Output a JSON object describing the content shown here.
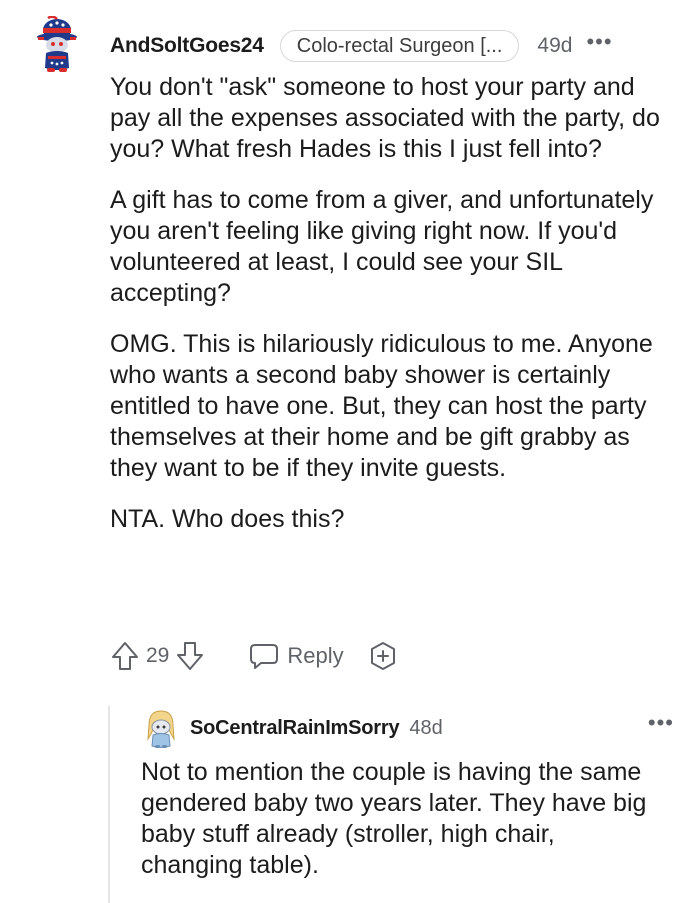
{
  "comment": {
    "username": "AndSoltGoes24",
    "flair": "Colo-rectal Surgeon [...",
    "age": "49d",
    "more_icon": "more-horizontal-icon",
    "paragraphs": [
      "You don't \"ask\" someone to host your party and pay all the expenses associated with the party, do you? What fresh Hades is this I just fell into?",
      "A gift has to come from a giver, and unfortunately you aren't feeling like giving right now. If you'd volunteered at least, I could see your SIL accepting?",
      "OMG. This is hilariously ridiculous to me. Anyone who wants a second baby shower is certainly entitled to have one. But, they can host the party themselves at their home and be gift grabby as they want to be if they invite guests.",
      "NTA. Who does this?"
    ],
    "actions": {
      "upvote_icon": "upvote-arrow-icon",
      "score": "29",
      "downvote_icon": "downvote-arrow-icon",
      "reply_icon": "speech-bubble-icon",
      "reply_label": "Reply",
      "award_icon": "award-plus-icon"
    }
  },
  "reply": {
    "username": "SoCentralRainImSorry",
    "age": "48d",
    "more_icon": "more-horizontal-icon",
    "text": "Not to mention the couple is having the same gendered baby two years later. They have big baby stuff already (stroller, high chair, changing table)."
  },
  "colors": {
    "text": "#1c1c1c",
    "meta": "#5f6368",
    "border": "#d8d8d8",
    "thread_line": "#e5e5e5"
  }
}
